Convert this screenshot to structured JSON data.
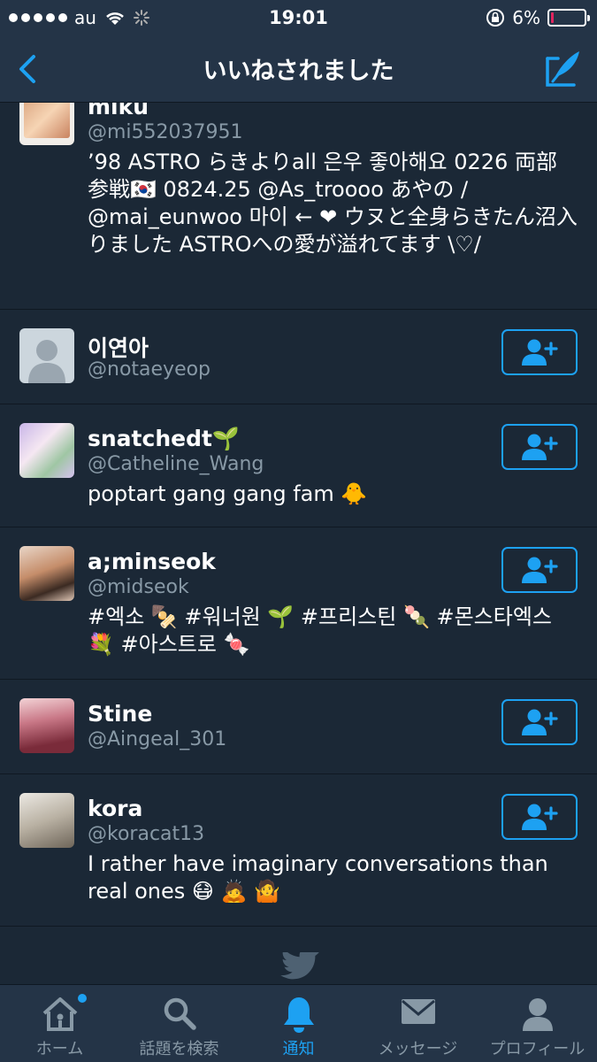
{
  "status_bar": {
    "carrier": "au",
    "time": "19:01",
    "battery": "6%",
    "battery_level": 0.06
  },
  "navbar": {
    "title": "いいねされました"
  },
  "users": [
    {
      "name": "miku",
      "handle": "@mi552037951",
      "bio": "’98 ASTRO らきよりall 은우 좋아해요 0226 両部参戦🇰🇷 0824.25 @As_troooo あやの / @mai_eunwoo 마이 ← ❤ ウヌと全身らきたん沼入りました ASTROへの愛が溢れてます \\♡/",
      "has_follow": false
    },
    {
      "name": "이연아",
      "handle": "@notaeyeop",
      "bio": "",
      "has_follow": true
    },
    {
      "name": "snatchedt🌱",
      "handle": "@Catheline_Wang",
      "bio": "poptart gang gang fam 🐥",
      "has_follow": true
    },
    {
      "name": "a;minseok",
      "handle": "@midseok",
      "bio": "#엑소 🍢 #워너원 🌱 #프리스틴 🍡 #몬스타엑스 💐 #아스트로 🍬",
      "has_follow": true
    },
    {
      "name": "Stine",
      "handle": "@Aingeal_301",
      "bio": "",
      "has_follow": true
    },
    {
      "name": "kora",
      "handle": "@koracat13",
      "bio": "I rather have imaginary conversations than real ones 😷 🙇 🤷",
      "has_follow": true
    }
  ],
  "tabbar": {
    "tabs": [
      {
        "label": "ホーム",
        "icon": "home-icon"
      },
      {
        "label": "話題を検索",
        "icon": "search-icon"
      },
      {
        "label": "通知",
        "icon": "bell-icon"
      },
      {
        "label": "メッセージ",
        "icon": "envelope-icon"
      },
      {
        "label": "プロフィール",
        "icon": "profile-icon"
      }
    ]
  },
  "colors": {
    "accent": "#1DA1F2",
    "background": "#1B2836",
    "bar": "#243447",
    "secondary_text": "#8899A6"
  }
}
